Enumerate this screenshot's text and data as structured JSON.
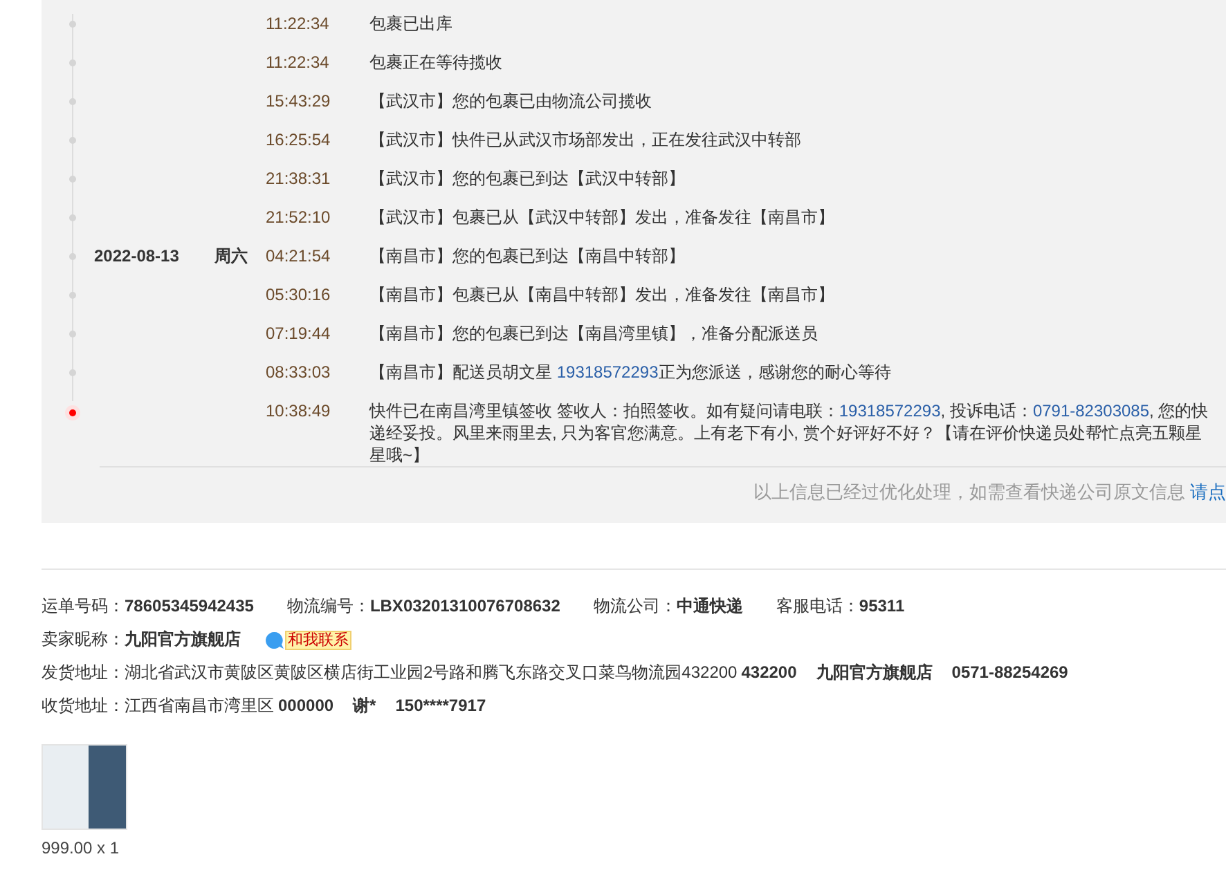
{
  "tracking": {
    "events": [
      {
        "time": "11:22:34",
        "current": false,
        "parts": [
          {
            "kind": "text",
            "text": "包裹已出库"
          }
        ]
      },
      {
        "time": "11:22:34",
        "current": false,
        "parts": [
          {
            "kind": "text",
            "text": "包裹正在等待揽收"
          }
        ]
      },
      {
        "time": "15:43:29",
        "current": false,
        "parts": [
          {
            "kind": "text",
            "text": "【武汉市】您的包裹已由物流公司揽收"
          }
        ]
      },
      {
        "time": "16:25:54",
        "current": false,
        "parts": [
          {
            "kind": "text",
            "text": "【武汉市】快件已从武汉市场部发出，正在发往武汉中转部"
          }
        ]
      },
      {
        "time": "21:38:31",
        "current": false,
        "parts": [
          {
            "kind": "text",
            "text": "【武汉市】您的包裹已到达【武汉中转部】"
          }
        ]
      },
      {
        "time": "21:52:10",
        "current": false,
        "parts": [
          {
            "kind": "text",
            "text": "【武汉市】包裹已从【武汉中转部】发出，准备发往【南昌市】"
          }
        ]
      },
      {
        "date": "2022-08-13",
        "weekday": "周六",
        "time": "04:21:54",
        "current": false,
        "parts": [
          {
            "kind": "text",
            "text": "【南昌市】您的包裹已到达【南昌中转部】"
          }
        ]
      },
      {
        "time": "05:30:16",
        "current": false,
        "parts": [
          {
            "kind": "text",
            "text": "【南昌市】包裹已从【南昌中转部】发出，准备发往【南昌市】"
          }
        ]
      },
      {
        "time": "07:19:44",
        "current": false,
        "parts": [
          {
            "kind": "text",
            "text": "【南昌市】您的包裹已到达【南昌湾里镇】，准备分配派送员"
          }
        ]
      },
      {
        "time": "08:33:03",
        "current": false,
        "parts": [
          {
            "kind": "text",
            "text": "【南昌市】配送员胡文星 "
          },
          {
            "kind": "phone",
            "text": "19318572293"
          },
          {
            "kind": "text",
            "text": "正为您派送，感谢您的耐心等待"
          }
        ]
      },
      {
        "time": "10:38:49",
        "current": true,
        "parts": [
          {
            "kind": "text",
            "text": "快件已在南昌湾里镇签收 签收人：拍照签收。如有疑问请电联："
          },
          {
            "kind": "phone",
            "text": "19318572293"
          },
          {
            "kind": "text",
            "text": ", 投诉电话："
          },
          {
            "kind": "phone",
            "text": "0791-82303085"
          },
          {
            "kind": "text",
            "text": ", 您的快递经妥投。风里来雨里去, 只为客官您满意。上有老下有小, 赏个好评好不好？【请在评价快递员处帮忙点亮五颗星星哦~】"
          }
        ]
      }
    ],
    "note": "以上信息已经过优化处理，如需查看快递公司原文信息",
    "note_link": "请点"
  },
  "info": {
    "waybill_row": [
      {
        "label": "运单号码：",
        "value": "78605345942435"
      },
      {
        "label": "物流编号：",
        "value": "LBX03201310076708632"
      },
      {
        "label": "物流公司：",
        "value": "中通快递"
      },
      {
        "label": "客服电话：",
        "value": "95311"
      }
    ],
    "seller": {
      "label": "卖家昵称：",
      "value": "九阳官方旗舰店",
      "contact": "和我联系"
    },
    "addresses": [
      {
        "label": "发货地址：",
        "address": "湖北省武汉市黄陂区黄陂区横店街工业园2号路和腾飞东路交叉口菜鸟物流园432200",
        "extras": [
          "432200",
          "九阳官方旗舰店",
          "0571-88254269"
        ]
      },
      {
        "label": "收货地址：",
        "address": "江西省南昌市湾里区",
        "extras": [
          "000000",
          "谢*",
          "150****7917"
        ]
      }
    ]
  },
  "product": {
    "price": "999.00 x 1"
  }
}
